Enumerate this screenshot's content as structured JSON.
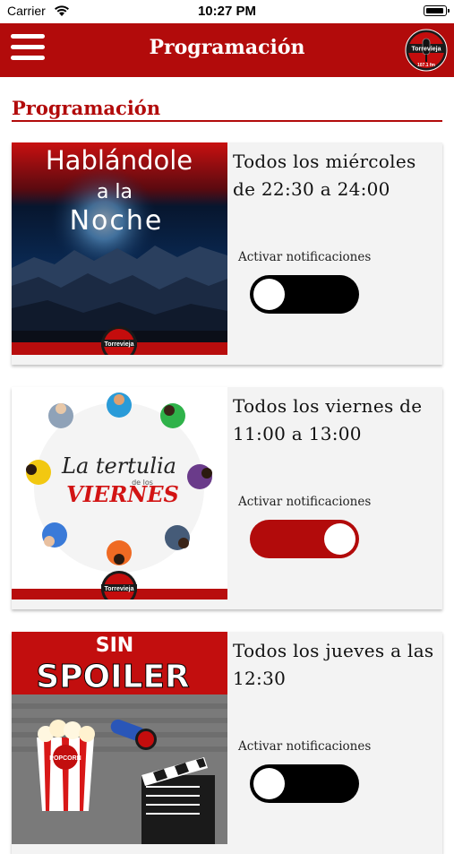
{
  "status_bar": {
    "carrier": "Carrier",
    "time": "10:27 PM"
  },
  "navbar": {
    "title": "Programación",
    "logo_text": "Torrevieja",
    "logo_freq": "107.1 fm"
  },
  "section": {
    "title": "Programación"
  },
  "colors": {
    "brand_red": "#b20b0b",
    "card_bg": "#f3f3f3"
  },
  "programs": [
    {
      "art_title_line1": "Hablándole",
      "art_title_line2": "a la",
      "art_title_line3": "Noche",
      "schedule": "Todos los miércoles de 22:30 a 24:00",
      "notif_label": "Activar notificaciones",
      "notifications_on": false,
      "badge": "Torrevieja"
    },
    {
      "art_title_line1": "La tertulia",
      "art_title_line2": "de los",
      "art_title_line3": "VIERNES",
      "schedule": "Todos los viernes de 11:00 a 13:00",
      "notif_label": "Activar notificaciones",
      "notifications_on": true,
      "badge": "Torrevieja"
    },
    {
      "art_title_line1": "SIN",
      "art_title_line2": "SPOILER",
      "art_title_line3": "POPCORN",
      "schedule": "Todos los jueves a las 12:30",
      "notif_label": "Activar notificaciones",
      "notifications_on": false,
      "badge": ""
    }
  ]
}
